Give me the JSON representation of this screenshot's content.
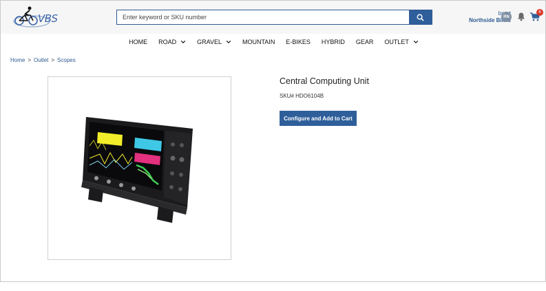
{
  "brand": {
    "logo_text": "VBS"
  },
  "search": {
    "placeholder": "Enter keyword or SKU number"
  },
  "user": {
    "username": "bnort",
    "store": "Northside Bikes",
    "initials": "RN"
  },
  "cart": {
    "count": "6"
  },
  "nav": [
    {
      "label": "HOME",
      "dropdown": false
    },
    {
      "label": "ROAD",
      "dropdown": true
    },
    {
      "label": "GRAVEL",
      "dropdown": true
    },
    {
      "label": "MOUNTAIN",
      "dropdown": false
    },
    {
      "label": "E-BIKES",
      "dropdown": false
    },
    {
      "label": "HYBRID",
      "dropdown": false
    },
    {
      "label": "GEAR",
      "dropdown": false
    },
    {
      "label": "OUTLET",
      "dropdown": true
    }
  ],
  "breadcrumb": [
    "Home",
    "Outlet",
    "Scopes"
  ],
  "product": {
    "title": "Central Computing Unit",
    "sku": "SKU# HDO6104B",
    "cta_label": "Configure and Add to Cart"
  },
  "colors": {
    "primary": "#2f5f9a",
    "badge": "#d9372b"
  }
}
